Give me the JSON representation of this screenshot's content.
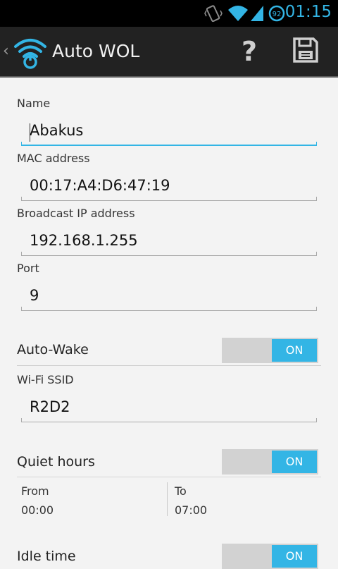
{
  "statusbar": {
    "time": "01:15",
    "battery_level": "92",
    "icons": [
      "vibrate-icon",
      "wifi-icon",
      "signal-icon",
      "battery-icon"
    ]
  },
  "actionbar": {
    "title": "Auto WOL",
    "help_label": "?",
    "icons": [
      "back-caret-icon",
      "wifi-power-logo-icon",
      "help-icon",
      "save-icon"
    ]
  },
  "form": {
    "name": {
      "label": "Name",
      "value": "Abakus"
    },
    "mac": {
      "label": "MAC address",
      "value": "00:17:A4:D6:47:19"
    },
    "broadcast": {
      "label": "Broadcast IP address",
      "value": "192.168.1.255"
    },
    "port": {
      "label": "Port",
      "value": "9"
    }
  },
  "autowake": {
    "label": "Auto-Wake",
    "toggle": "ON",
    "ssid": {
      "label": "Wi-Fi SSID",
      "value": "R2D2"
    }
  },
  "quiet_hours": {
    "label": "Quiet hours",
    "toggle": "ON",
    "from": {
      "label": "From",
      "value": "00:00"
    },
    "to": {
      "label": "To",
      "value": "07:00"
    }
  },
  "idle_time": {
    "label": "Idle time",
    "toggle": "ON"
  },
  "colors": {
    "accent": "#33b5e5",
    "actionbar_bg": "#222222",
    "background": "#f3f3f3"
  }
}
